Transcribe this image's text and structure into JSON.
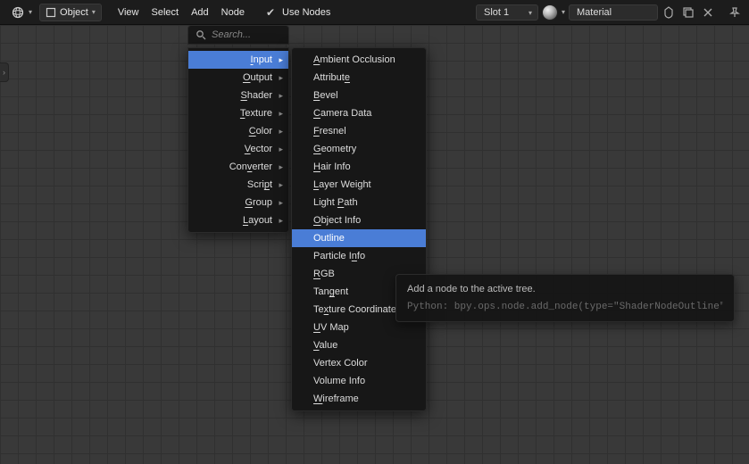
{
  "header": {
    "editor_icon": "sphere-editor",
    "mode_label": "Object",
    "menus": [
      "View",
      "Select",
      "Add",
      "Node"
    ],
    "use_nodes_label": "Use Nodes",
    "use_nodes_checked": true,
    "slot_label": "Slot 1",
    "material_name": "Material"
  },
  "search": {
    "placeholder": "Search..."
  },
  "menu_categories": [
    {
      "label": "Input",
      "u": 0,
      "active": true
    },
    {
      "label": "Output",
      "u": 0
    },
    {
      "label": "Shader",
      "u": 0
    },
    {
      "label": "Texture",
      "u": 0
    },
    {
      "label": "Color",
      "u": 0
    },
    {
      "label": "Vector",
      "u": 0
    },
    {
      "label": "Converter",
      "u": 3
    },
    {
      "label": "Script",
      "u": 4
    },
    {
      "label": "Group",
      "u": 0
    },
    {
      "label": "Layout",
      "u": 0
    }
  ],
  "submenu_input": [
    {
      "label": "Ambient Occlusion",
      "u": 0
    },
    {
      "label": "Attribute",
      "u": 8
    },
    {
      "label": "Bevel",
      "u": 0
    },
    {
      "label": "Camera Data",
      "u": 0
    },
    {
      "label": "Fresnel",
      "u": 0
    },
    {
      "label": "Geometry",
      "u": 0
    },
    {
      "label": "Hair Info",
      "u": 0
    },
    {
      "label": "Layer Weight",
      "u": 0
    },
    {
      "label": "Light Path",
      "u": 6
    },
    {
      "label": "Object Info",
      "u": 0
    },
    {
      "label": "Outline",
      "u": -1,
      "active": true
    },
    {
      "label": "Particle Info",
      "u": 10
    },
    {
      "label": "RGB",
      "u": 0
    },
    {
      "label": "Tangent",
      "u": 3
    },
    {
      "label": "Texture Coordinate",
      "u": 2
    },
    {
      "label": "UV Map",
      "u": 0
    },
    {
      "label": "Value",
      "u": 0
    },
    {
      "label": "Vertex Color",
      "u": -1
    },
    {
      "label": "Volume Info",
      "u": -1
    },
    {
      "label": "Wireframe",
      "u": 0
    }
  ],
  "tooltip": {
    "title": "Add a node to the active tree.",
    "python": "Python: bpy.ops.node.add_node(type=\"ShaderNodeOutline\", ... )"
  }
}
